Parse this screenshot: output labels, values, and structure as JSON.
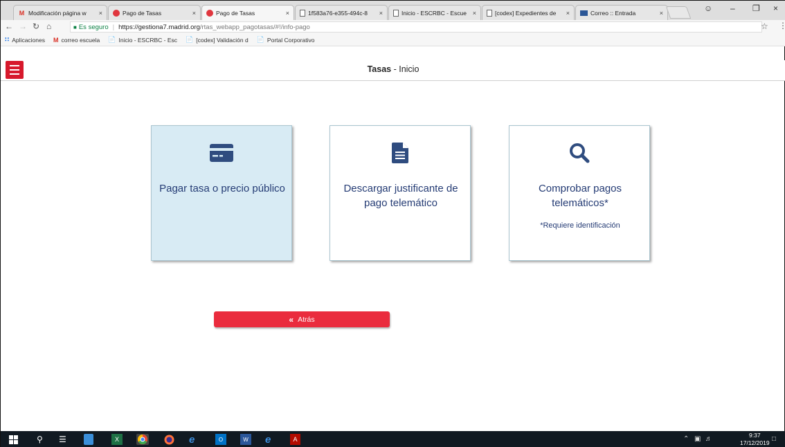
{
  "browser": {
    "tabs": [
      {
        "label": "Modificación página w",
        "icon": "gmail-icon"
      },
      {
        "label": "Pago de Tasas",
        "icon": "red-circle-icon"
      },
      {
        "label": "Pago de Tasas",
        "icon": "red-circle-icon",
        "active": true
      },
      {
        "label": "1f583a76-e355-494c-8",
        "icon": "document-icon"
      },
      {
        "label": "Inicio - ESCRBC - Escue",
        "icon": "document-icon"
      },
      {
        "label": "[codex] Expedientes de",
        "icon": "document-icon"
      },
      {
        "label": "Correo :: Entrada",
        "icon": "mail-icon"
      }
    ],
    "tab_close": "×",
    "address": {
      "secure_label": "Es seguro",
      "url_scheme_host": "https://gestiona7.madrid.org",
      "url_path": "/rtas_webapp_pagotasas/#!/info-pago"
    },
    "bookmarks": [
      {
        "label": "Aplicaciones",
        "icon": "apps-grid-icon"
      },
      {
        "label": "correo escuela",
        "icon": "gmail-icon"
      },
      {
        "label": "Inicio - ESCRBC - Esc",
        "icon": "document-icon"
      },
      {
        "label": "[codex] Validación d",
        "icon": "document-icon"
      },
      {
        "label": "Portal Corporativo",
        "icon": "document-icon"
      }
    ]
  },
  "app": {
    "title_bold": "Tasas",
    "title_rest": " - Inicio",
    "cards": [
      {
        "icon": "credit-card-icon",
        "text": "Pagar tasa o precio público",
        "note": ""
      },
      {
        "icon": "document-icon",
        "text": "Descargar justificante de pago telemático",
        "note": ""
      },
      {
        "icon": "search-icon",
        "text": "Comprobar pagos telemáticos*",
        "note": "*Requiere identificación"
      }
    ],
    "back_label": "Atrás",
    "back_icon": "«"
  },
  "taskbar": {
    "time": "9:37",
    "date": "17/12/2019"
  },
  "colors": {
    "brand_red": "#d7192c",
    "card_text": "#243b74",
    "card_selected_bg": "#d8ebf4"
  }
}
